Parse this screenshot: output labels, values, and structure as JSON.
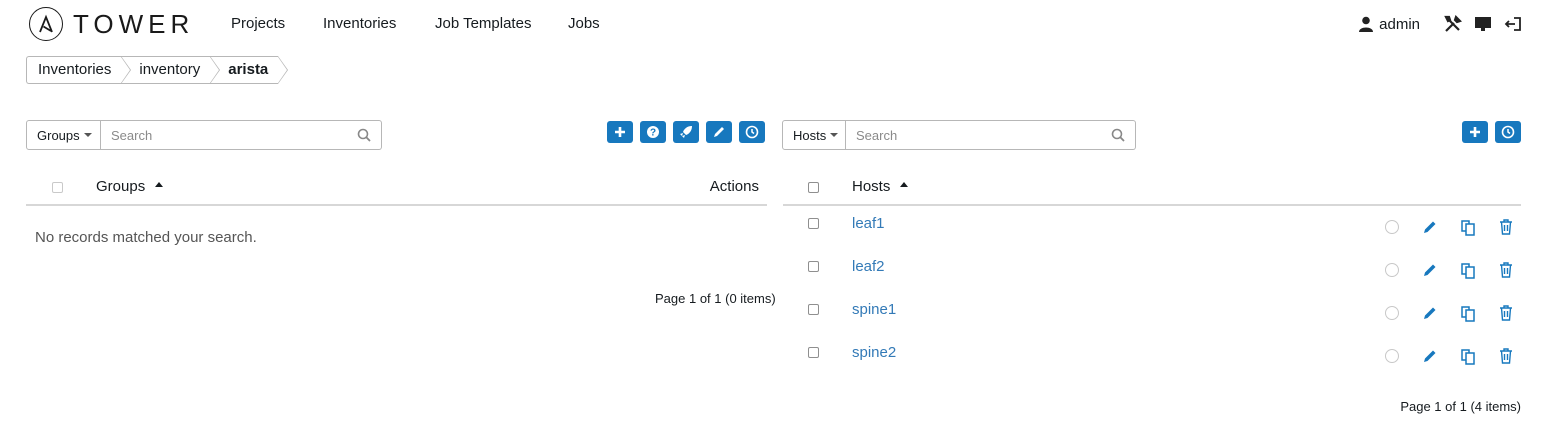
{
  "app": {
    "logo_text": "TOWER"
  },
  "nav": {
    "links": [
      "Projects",
      "Inventories",
      "Job Templates",
      "Jobs"
    ],
    "user": "admin"
  },
  "breadcrumb": [
    "Inventories",
    "inventory",
    "arista"
  ],
  "groups_panel": {
    "search_select": "Groups",
    "search_placeholder": "Search",
    "column_header": "Groups",
    "actions_header": "Actions",
    "empty_message": "No records matched your search.",
    "pager": "Page 1 of 1 (0 items)",
    "buttons": [
      "add-icon",
      "help-icon",
      "rocket-icon",
      "edit-icon",
      "history-icon"
    ]
  },
  "hosts_panel": {
    "search_select": "Hosts",
    "search_placeholder": "Search",
    "column_header": "Hosts",
    "pager": "Page 1 of 1 (4 items)",
    "buttons": [
      "add-icon",
      "history-icon"
    ],
    "rows": [
      {
        "name": "leaf1"
      },
      {
        "name": "leaf2"
      },
      {
        "name": "spine1"
      },
      {
        "name": "spine2"
      }
    ]
  },
  "colors": {
    "accent": "#1778be",
    "link": "#337ab7",
    "border": "#b7b7b7"
  }
}
